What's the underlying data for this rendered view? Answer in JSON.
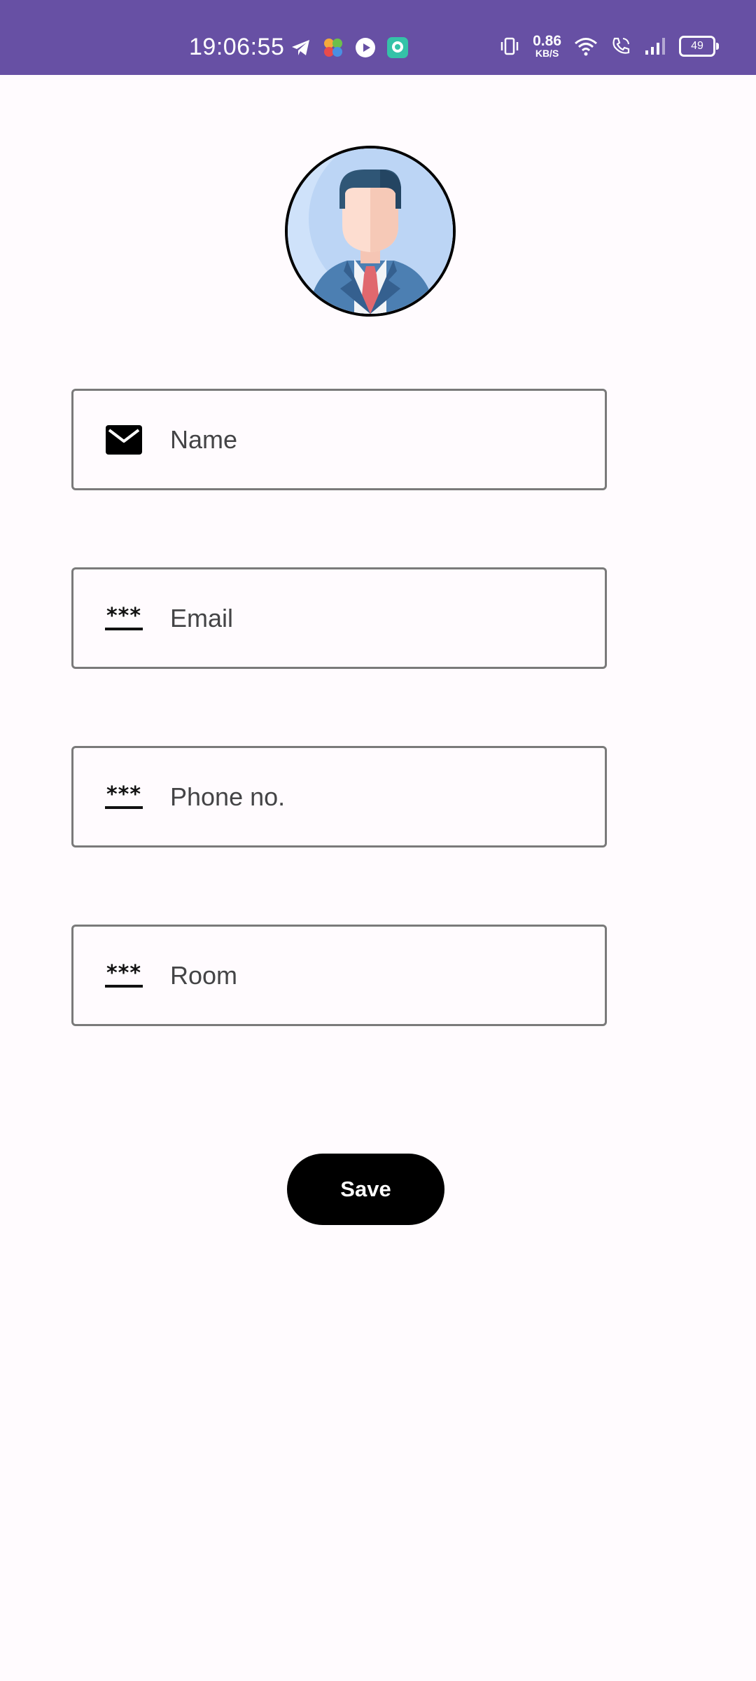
{
  "status_bar": {
    "time": "19:06:55",
    "net_speed_value": "0.86",
    "net_speed_unit": "KB/S",
    "battery": "49",
    "background_color": "#6750a4"
  },
  "avatar": {
    "icon": "businessman-avatar-icon"
  },
  "form": {
    "name_placeholder": "Name",
    "email_placeholder": "Email",
    "phone_placeholder": "Phone no.",
    "room_placeholder": "Room",
    "name_icon": "envelope-icon",
    "email_icon": "password-icon",
    "phone_icon": "password-icon",
    "room_icon": "password-icon"
  },
  "save_button": {
    "label": "Save"
  },
  "colors": {
    "accent": "#6750a4",
    "page_background": "#fffbfe",
    "button_background": "#000000"
  }
}
